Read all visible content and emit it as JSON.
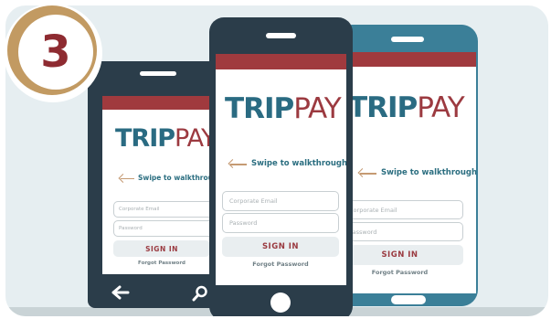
{
  "step": {
    "number": "3"
  },
  "logo": {
    "part1": "TRIP",
    "part2": "PAY"
  },
  "login": {
    "swipe_hint": "Swipe to walkthrough",
    "email_placeholder": "Corporate Email",
    "password_placeholder": "Password",
    "signin_label": "SIGN IN",
    "forgot_label": "Forgot Password"
  },
  "colors": {
    "tablet_body": "#2b3d4a",
    "phone_dark": "#2b3d4a",
    "phone_blue": "#3b7f98",
    "header_bar": "#a03a3e",
    "badge_ring": "#c29a62",
    "badge_number": "#8e2b31"
  },
  "icons": [
    "back-arrow-icon",
    "search-icon",
    "home-button-icon",
    "left-arrow-icon"
  ]
}
